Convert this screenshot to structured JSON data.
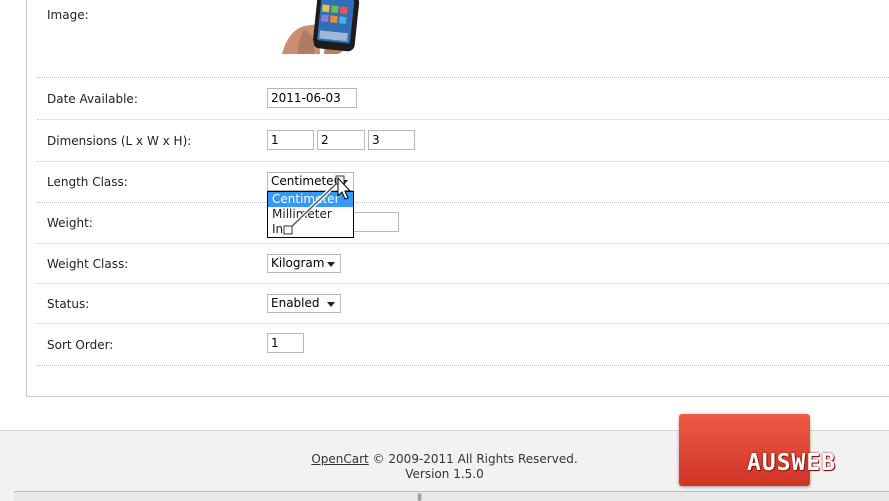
{
  "form": {
    "image_label": "Image:",
    "date_available": {
      "label": "Date Available:",
      "value": "2011-06-03"
    },
    "dimensions": {
      "label": "Dimensions (L x W x H):",
      "length": "1",
      "width": "2",
      "height": "3"
    },
    "length_class": {
      "label": "Length Class:",
      "selected": "Centimeter",
      "options": [
        "Centimeter",
        "Millimeter",
        "Inch"
      ],
      "visible_option_texts": [
        "Centimeter",
        "Millimeter",
        "Inc"
      ]
    },
    "weight": {
      "label": "Weight:",
      "value": ""
    },
    "weight_class": {
      "label": "Weight Class:",
      "selected": "Kilogram"
    },
    "status": {
      "label": "Status:",
      "selected": "Enabled"
    },
    "sort_order": {
      "label": "Sort Order:",
      "value": "1"
    }
  },
  "footer": {
    "link": "OpenCart",
    "copyright": "© 2009-2011 All Rights Reserved.",
    "version": "Version 1.5.0"
  },
  "watermark": {
    "text": "AUSWEB",
    "color": "#d93a2b"
  }
}
